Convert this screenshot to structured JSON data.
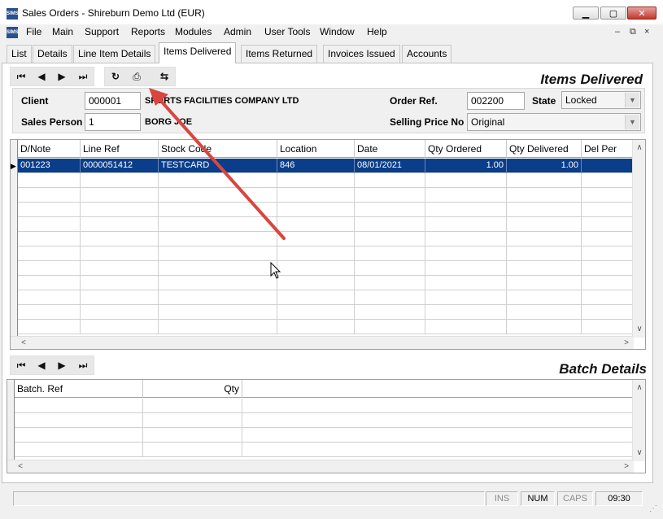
{
  "window": {
    "title": "Sales Orders - Shireburn Demo Ltd (EUR)",
    "icon_label": "SIMS",
    "controls": [
      "minimize-icon",
      "maximize-icon",
      "close-icon"
    ]
  },
  "menu": {
    "items": [
      "File",
      "Main",
      "Support",
      "Reports",
      "Modules",
      "Admin",
      "User Tools",
      "Window",
      "Help"
    ],
    "mdi": [
      "–",
      "⧉",
      "×"
    ]
  },
  "tabs": [
    {
      "label": "List",
      "active": false
    },
    {
      "label": "Details",
      "active": false
    },
    {
      "label": "Line Item Details",
      "active": false
    },
    {
      "label": "Items Delivered",
      "active": true
    },
    {
      "label": "Items Returned",
      "active": false
    },
    {
      "label": "Invoices Issued",
      "active": false
    },
    {
      "label": "Accounts",
      "active": false
    }
  ],
  "toolbar": {
    "nav_icons": [
      "first-record-icon",
      "previous-record-icon",
      "next-record-icon",
      "last-record-icon"
    ],
    "action_icons": [
      "refresh-icon",
      "print-icon",
      "swap-icon"
    ]
  },
  "section_title": "Items Delivered",
  "form": {
    "client_label": "Client",
    "client_code": "000001",
    "client_name": "SPORTS FACILITIES COMPANY LTD",
    "sales_person_label": "Sales Person",
    "sales_person_code": "1",
    "sales_person_name": "BORG JOE",
    "order_ref_label": "Order Ref.",
    "order_ref": "002200",
    "state_label": "State",
    "state": "Locked",
    "selling_price_label": "Selling Price No",
    "selling_price": "Original"
  },
  "delivered_grid": {
    "columns": [
      "D/Note",
      "Line Ref",
      "Stock Code",
      "Location",
      "Date",
      "Qty Ordered",
      "Qty Delivered",
      "Del Per"
    ],
    "rows": [
      {
        "dnote": "001223",
        "line_ref": "0000051412",
        "stock_code": "TESTCARD",
        "location": "846",
        "date": "08/01/2021",
        "qty_ordered": "1.00",
        "qty_delivered": "1.00",
        "del_per": ""
      }
    ]
  },
  "batch_title": "Batch Details",
  "batch_grid": {
    "columns": [
      "Batch. Ref",
      "Qty"
    ]
  },
  "statusbar": {
    "ins": "INS",
    "num": "NUM",
    "caps": "CAPS",
    "time": "09:30"
  },
  "colors": {
    "selection": "#0a3d8a",
    "annotation_arrow": "#d9463f"
  }
}
